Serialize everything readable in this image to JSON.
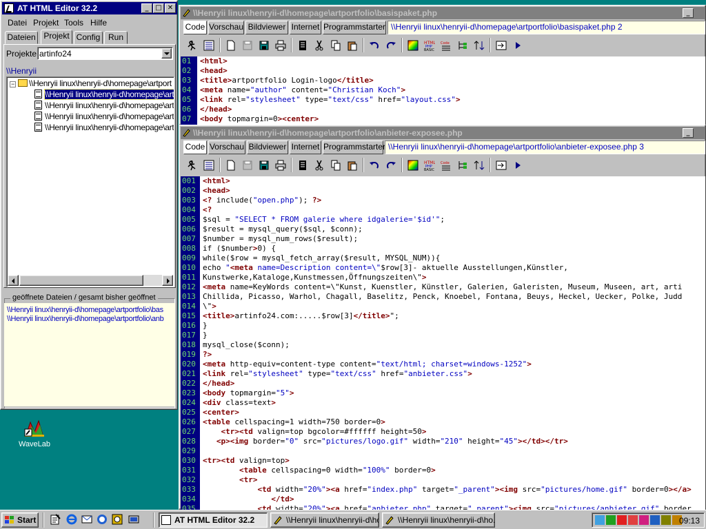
{
  "left_window": {
    "title": "AT HTML Editor 32.2",
    "menu": [
      "Datei",
      "Projekt",
      "Tools",
      "Hilfe"
    ],
    "tabs": [
      "Dateien",
      "Projekt",
      "Config",
      "Run"
    ],
    "active_tab": "Projekt",
    "projects_label": "Projekte",
    "project_value": "artinfo24",
    "path_label": "\\\\Henryii",
    "tree_root": "\\\\Henryii linux\\henryii-d\\homepage\\artport",
    "tree_items": [
      "\\\\Henryii linux\\henryii-d\\homepage\\art",
      "\\\\Henryii linux\\henryii-d\\homepage\\art",
      "\\\\Henryii linux\\henryii-d\\homepage\\art",
      "\\\\Henryii linux\\henryii-d\\homepage\\art"
    ],
    "opened_legend": "geöffnete Dateien / gesamt bisher geöffnet",
    "opened_files": [
      "\\\\Henryii linux\\henryii-d\\homepage\\artportfolio\\bas",
      "\\\\Henryii linux\\henryii-d\\homepage\\artportfolio\\anb"
    ]
  },
  "desktop": {
    "icon_label": "WaveLab"
  },
  "editor_top": {
    "title": "\\\\Henryii linux\\henryii-d\\homepage\\artportfolio\\basispaket.php",
    "tabs": [
      "Code",
      "Vorschau",
      "Bildviewer",
      "Internet",
      "Programmstarter"
    ],
    "active_tab": "Code",
    "path": "\\\\Henryii linux\\henryii-d\\homepage\\artportfolio\\basispaket.php 2",
    "lines": [
      {
        "n": "01",
        "t": "<html>"
      },
      {
        "n": "02",
        "t": "<head>"
      },
      {
        "n": "03",
        "t": "<title>artportfolio Login-logo</title>"
      },
      {
        "n": "04",
        "t": "<meta name=\"author\" content=\"Christian Koch\">"
      },
      {
        "n": "05",
        "t": "<link rel=\"stylesheet\" type=\"text/css\" href=\"layout.css\">"
      },
      {
        "n": "06",
        "t": "</head>"
      },
      {
        "n": "07",
        "t": "<body topmargin=0><center>"
      }
    ]
  },
  "editor_bottom": {
    "title": "\\\\Henryii linux\\henryii-d\\homepage\\artportfolio\\anbieter-exposee.php",
    "tabs": [
      "Code",
      "Vorschau",
      "Bildviewer",
      "Internet",
      "Programmstarter"
    ],
    "active_tab": "Code",
    "path": "\\\\Henryii linux\\henryii-d\\homepage\\artportfolio\\anbieter-exposee.php 3",
    "lines": [
      {
        "n": "001",
        "t": "<html>"
      },
      {
        "n": "002",
        "t": "<head>"
      },
      {
        "n": "003",
        "t": "<? include(\"open.php\"); ?>"
      },
      {
        "n": "004",
        "t": "<?"
      },
      {
        "n": "005",
        "t": "$sql = \"SELECT * FROM galerie where idgalerie='$id'\";"
      },
      {
        "n": "006",
        "t": "$result = mysql_query($sql, $conn);"
      },
      {
        "n": "007",
        "t": "$number = mysql_num_rows($result);"
      },
      {
        "n": "008",
        "t": "if ($number>0) {"
      },
      {
        "n": "009",
        "t": "while($row = mysql_fetch_array($result, MYSQL_NUM)){"
      },
      {
        "n": "010",
        "t": "echo \"<meta name=Description content=\\\"$row[3]- aktuelle Ausstellungen,Künstler,"
      },
      {
        "n": "011",
        "t": "Kunstwerke,Kataloge,Kunstmessen,Öffnungszeiten\\\">"
      },
      {
        "n": "012",
        "t": "<meta name=KeyWords content=\\\"Kunst, Kuenstler, Künstler, Galerien, Galeristen, Museum, Museen, art, arti"
      },
      {
        "n": "013",
        "t": "Chillida, Picasso, Warhol, Chagall, Baselitz, Penck, Knoebel, Fontana, Beuys, Heckel, Uecker, Polke, Judd"
      },
      {
        "n": "014",
        "t": "\\\">"
      },
      {
        "n": "015",
        "t": "<title>artinfo24.com:.....$row[3]</title>\";"
      },
      {
        "n": "016",
        "t": "}"
      },
      {
        "n": "017",
        "t": "}"
      },
      {
        "n": "018",
        "t": "mysql_close($conn);"
      },
      {
        "n": "019",
        "t": "?>"
      },
      {
        "n": "020",
        "t": "<meta http-equiv=content-type content=\"text/html; charset=windows-1252\">"
      },
      {
        "n": "021",
        "t": "<link rel=\"stylesheet\" type=\"text/css\" href=\"anbieter.css\">"
      },
      {
        "n": "022",
        "t": "</head>"
      },
      {
        "n": "023",
        "t": "<body topmargin=\"5\">"
      },
      {
        "n": "024",
        "t": "<div class=text>"
      },
      {
        "n": "025",
        "t": "<center>"
      },
      {
        "n": "026",
        "t": "<table cellspacing=1 width=750 border=0>"
      },
      {
        "n": "027",
        "t": "    <tr><td valign=top bgcolor=#ffffff height=50>"
      },
      {
        "n": "028",
        "t": "   <p><img border=\"0\" src=\"pictures/logo.gif\" width=\"210\" height=\"45\"></td></tr>"
      },
      {
        "n": "029",
        "t": ""
      },
      {
        "n": "030",
        "t": "<tr><td valign=top>"
      },
      {
        "n": "031",
        "t": "        <table cellspacing=0 width=\"100%\" border=0>"
      },
      {
        "n": "032",
        "t": "        <tr>"
      },
      {
        "n": "033",
        "t": "            <td width=\"20%\"><a href=\"index.php\" target=\"_parent\"><img src=\"pictures/home.gif\" border=0></a>"
      },
      {
        "n": "034",
        "t": "               </td>"
      },
      {
        "n": "035",
        "t": "            <td width=\"20%\"><a href=\"anbieter.php\" target=\"_parent\"><img src=\"pictures/anbieter.gif\" border"
      }
    ]
  },
  "taskbar": {
    "start_label": "Start",
    "tasks": [
      {
        "label": "AT HTML Editor 32.2",
        "active": true
      },
      {
        "label": "\\\\Henryii linux\\henryii-d\\ho...",
        "active": false
      },
      {
        "label": "\\\\Henryii linux\\henryii-d\\ho...",
        "active": false
      }
    ],
    "clock": "09:13"
  },
  "colors": {
    "desktop": "#008080",
    "title_active": "#000080",
    "title_inactive": "#808080",
    "gutter": "#000080",
    "path_bg": "#ffffe6"
  }
}
